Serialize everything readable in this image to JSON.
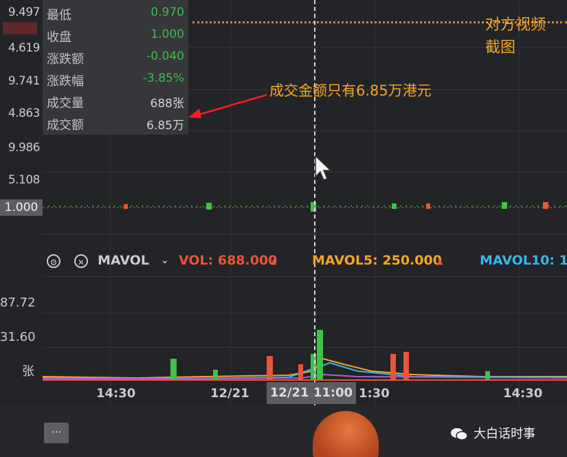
{
  "price_axis": {
    "labels": [
      "9.497",
      "4.619",
      "9.741",
      "4.863",
      "9.986",
      "5.108"
    ],
    "current": "1.000"
  },
  "info_panel": {
    "rows": [
      {
        "key": "最低",
        "value": "0.970",
        "color": "#3fc24a"
      },
      {
        "key": "收盘",
        "value": "1.000",
        "color": "#3fc24a"
      },
      {
        "key": "涨跌额",
        "value": "-0.040",
        "color": "#3fc24a"
      },
      {
        "key": "涨跌幅",
        "value": "-3.85%",
        "color": "#3fc24a"
      },
      {
        "key": "成交量",
        "value": "688张",
        "color": "#d8d8d8"
      },
      {
        "key": "成交额",
        "value": "6.85万",
        "color": "#d8d8d8"
      }
    ]
  },
  "annotation": {
    "text": "成交金额只有6.85万港元",
    "color": "#f5a623"
  },
  "corner_note": {
    "line1": "对方视频",
    "line2": "截图"
  },
  "toolbar": {
    "indicator": "MAVOL",
    "vol_label": "VOL: 688.000",
    "mavol5_label": "MAVOL5: 250.000",
    "mavol10_label": "MAVOL10: 1",
    "vol_color": "#e8553a",
    "mavol5_color": "#f5a623",
    "mavol10_color": "#38b6e8"
  },
  "volume_axis": {
    "labels": [
      "87.72",
      "31.60",
      "张"
    ]
  },
  "time_axis": {
    "labels": [
      "14:30",
      "12/21",
      "1:30",
      "14:30"
    ],
    "highlight": "12/21 11:00"
  },
  "watermark": {
    "text": "大白话时事"
  },
  "more_button": {
    "label": "···"
  },
  "colors": {
    "up": "#e8553a",
    "down": "#3fc24a",
    "background": "#232427"
  }
}
